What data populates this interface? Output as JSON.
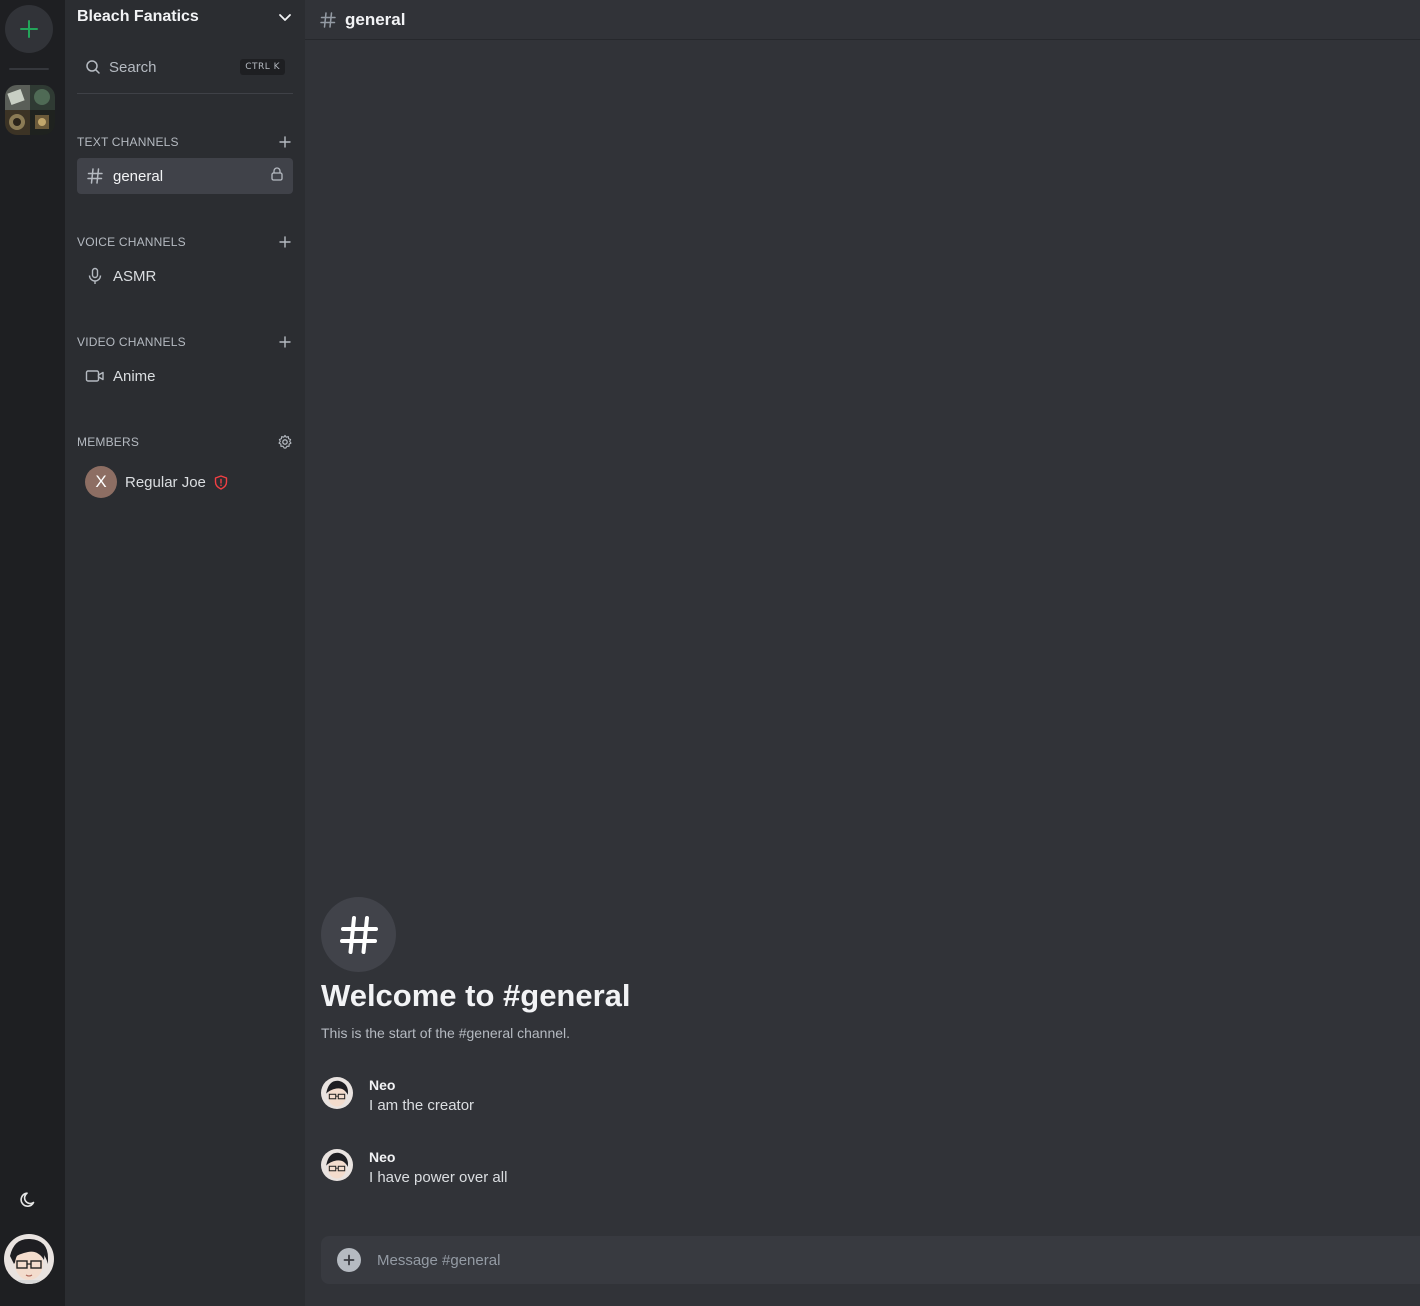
{
  "rail": {
    "add_server_icon": "plus-icon",
    "server_icon": "server-collage-image",
    "theme_icon": "moon-icon",
    "user_avatar": "anime-avatar-image"
  },
  "sidebar": {
    "server_name": "Bleach Fanatics",
    "search": {
      "label": "Search",
      "shortcut": "CTRL K"
    },
    "sections": {
      "text": {
        "title": "TEXT CHANNELS",
        "channels": [
          {
            "label": "general",
            "icon": "hash-icon",
            "locked": true,
            "active": true
          }
        ]
      },
      "voice": {
        "title": "VOICE CHANNELS",
        "channels": [
          {
            "label": "ASMR",
            "icon": "microphone-icon"
          }
        ]
      },
      "video": {
        "title": "VIDEO CHANNELS",
        "channels": [
          {
            "label": "Anime",
            "icon": "video-camera-icon"
          }
        ]
      },
      "members": {
        "title": "MEMBERS",
        "list": [
          {
            "initial": "X",
            "name": "Regular Joe",
            "badge": "shield-icon"
          }
        ]
      }
    }
  },
  "main": {
    "channel_name": "general",
    "welcome": {
      "title": "Welcome to #general",
      "subtitle": "This is the start of the #general channel."
    },
    "messages": [
      {
        "author": "Neo",
        "content": "I am the creator"
      },
      {
        "author": "Neo",
        "content": "I have power over all"
      }
    ],
    "composer": {
      "placeholder": "Message #general"
    }
  },
  "colors": {
    "accent_green": "#23a55a",
    "badge_red": "#f23f43",
    "background": "#313338",
    "sidebar": "#2b2d31",
    "rail": "#1e1f22"
  }
}
